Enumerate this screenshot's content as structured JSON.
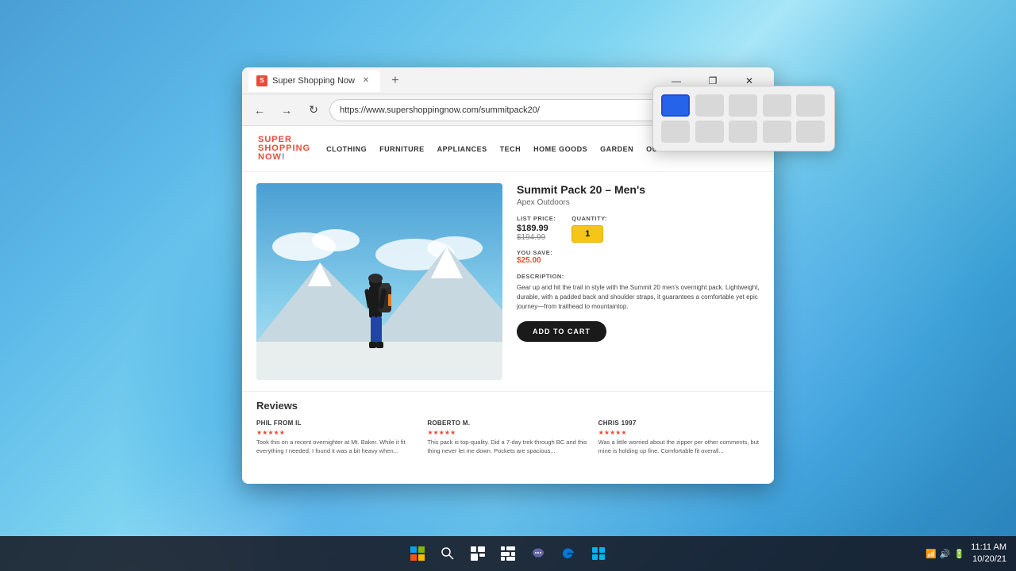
{
  "window": {
    "title": "Super Shopping Now",
    "url": "https://www.supershoppingnow.com/summitpack20/"
  },
  "browser": {
    "nav": {
      "back_label": "←",
      "forward_label": "→",
      "refresh_label": "↻"
    },
    "controls": {
      "minimize": "—",
      "maximize": "❐",
      "close": "✕"
    }
  },
  "site": {
    "logo": {
      "line1": "SUPER",
      "line2": "SHOPPING",
      "line3": "NOW",
      "exclaim": "!"
    },
    "nav": [
      "CLOTHING",
      "FURNITURE",
      "APPLIANCES",
      "TECH",
      "HOME GOODS",
      "GARDEN",
      "OUTDOOR"
    ]
  },
  "product": {
    "title": "Summit Pack 20 – Men's",
    "brand": "Apex Outdoors",
    "list_price_label": "LIST PRICE:",
    "price_current": "$189.99",
    "price_original": "$194.99",
    "quantity_label": "QUANTITY:",
    "quantity_value": "1",
    "savings_label": "YOU SAVE:",
    "savings_amount": "$25.00",
    "description_label": "DESCRIPTION:",
    "description": "Gear up and hit the trail in style with the Summit 20 men's overnight pack. Lightweight, durable, with a padded back and shoulder straps, it guarantees a comfortable yet epic journey—from trailhead to mountaintop.",
    "add_to_cart": "ADD TO CART"
  },
  "reviews": {
    "title": "Reviews",
    "items": [
      {
        "name": "PHIL FROM IL",
        "stars": "★★★★★",
        "text": "Took this on a recent overnighter at Mt. Baker. While it fit everything I needed, I found it was a bit heavy when..."
      },
      {
        "name": "ROBERTO M.",
        "stars": "★★★★★",
        "text": "This pack is top-quality. Did a 7-day trek through BC and this thing never let me down. Pockets are spacious..."
      },
      {
        "name": "CHRIS 1997",
        "stars": "★★★★★",
        "text": "Was a little worried about the zipper per other comments, but mine is holding up fine. Comfortable fit overall..."
      }
    ]
  },
  "taskbar": {
    "time": "11:11 AM",
    "date": "10/20/21",
    "icons": [
      "⊞",
      "🔍",
      "📁",
      "▦",
      "💬",
      "🌐",
      "📦"
    ]
  }
}
